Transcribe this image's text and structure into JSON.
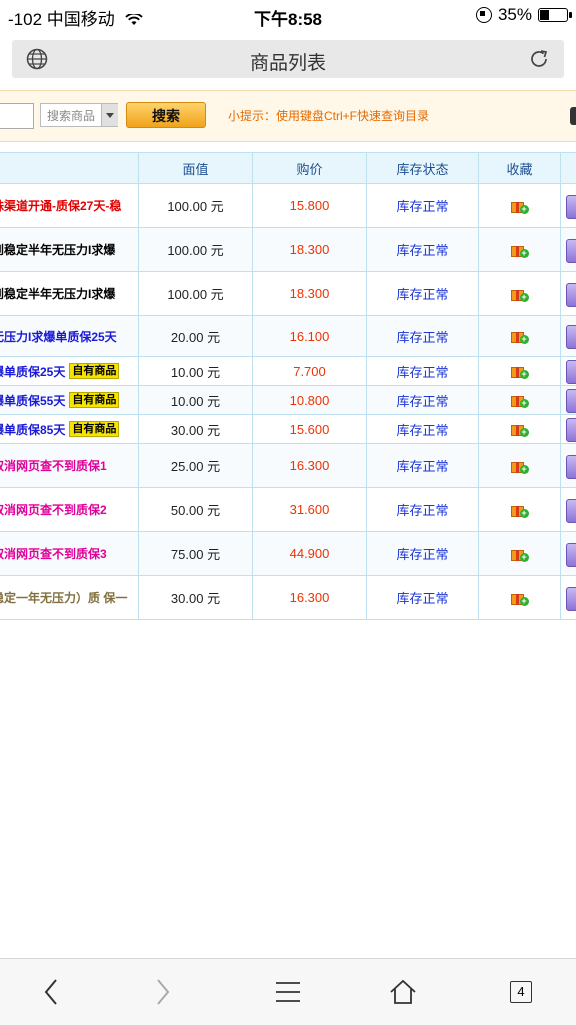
{
  "status": {
    "carrier": "-102 中国移动",
    "time": "下午8:58",
    "battery": "35%"
  },
  "addressbar": {
    "title": "商品列表"
  },
  "search": {
    "placeholder": "搜索商品",
    "button": "搜索",
    "tip": "小提示：使用键盘Ctrl+F快速查询目录"
  },
  "table": {
    "headers": {
      "face": "面值",
      "price": "购价",
      "stock": "库存状态",
      "fav": "收藏"
    },
    "own_label": "自有商品",
    "rows": [
      {
        "name": "殊渠道开通-质保27天-稳",
        "face": "100.00 元",
        "price": "15.800",
        "stock": "库存正常",
        "color": "#e00000"
      },
      {
        "name": "到稳定半年无压力I求爆",
        "face": "100.00 元",
        "price": "18.300",
        "stock": "库存正常",
        "color": "#000000"
      },
      {
        "name": "到稳定半年无压力I求爆",
        "face": "100.00 元",
        "price": "18.300",
        "stock": "库存正常",
        "color": "#000000"
      },
      {
        "name": "无压力I求爆单质保25天",
        "face": "20.00 元",
        "price": "16.100",
        "stock": "库存正常",
        "color": "#1a1ad6"
      },
      {
        "name": "爆单质保25天",
        "face": "10.00 元",
        "price": "7.700",
        "stock": "库存正常",
        "color": "#1a1ad6",
        "own": true
      },
      {
        "name": "爆单质保55天",
        "face": "10.00 元",
        "price": "10.800",
        "stock": "库存正常",
        "color": "#1a1ad6",
        "own": true
      },
      {
        "name": "爆单质保85天",
        "face": "30.00 元",
        "price": "15.600",
        "stock": "库存正常",
        "color": "#1a1ad6",
        "own": true
      },
      {
        "name": "取消网页查不到质保1",
        "face": "25.00 元",
        "price": "16.300",
        "stock": "库存正常",
        "color": "#e0009a"
      },
      {
        "name": "取消网页查不到质保2",
        "face": "50.00 元",
        "price": "31.600",
        "stock": "库存正常",
        "color": "#e0009a"
      },
      {
        "name": "取消网页查不到质保3",
        "face": "75.00 元",
        "price": "44.900",
        "stock": "库存正常",
        "color": "#e0009a"
      },
      {
        "name": "稳定一年无压力）质 保一",
        "face": "30.00 元",
        "price": "16.300",
        "stock": "库存正常",
        "color": "#807040"
      }
    ]
  },
  "bottom": {
    "tabs_count": "4"
  }
}
